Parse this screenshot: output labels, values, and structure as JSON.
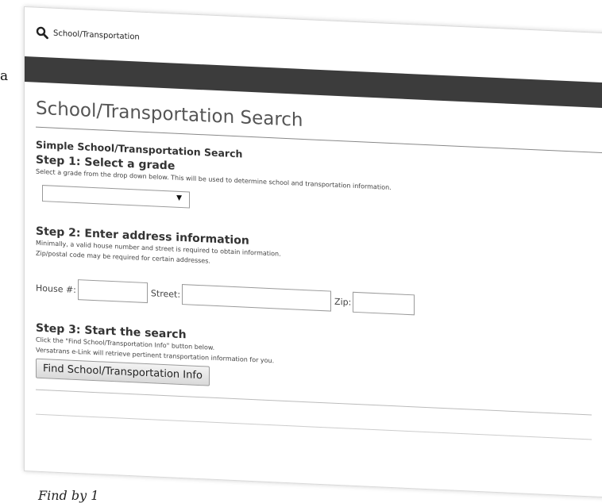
{
  "background": {
    "left_fragment": "a",
    "caption": "Find by 1"
  },
  "app": {
    "title": "School/Transportation",
    "icon": "search-icon"
  },
  "page": {
    "title": "School/Transportation Search",
    "section_title": "Simple School/Transportation Search"
  },
  "step1": {
    "title": "Step 1: Select a grade",
    "help": "Select a grade from the drop down below. This will be used to determine school and transportation information.",
    "grade_value": "",
    "arrow": "▼"
  },
  "step2": {
    "title": "Step 2: Enter address information",
    "help_line1": "Minimally, a valid house number and street is required to obtain information.",
    "help_line2": "Zip/postal code may be required for certain addresses.",
    "house_label": "House #:",
    "street_label": "Street:",
    "zip_label": "Zip:",
    "house_value": "",
    "street_value": "",
    "zip_value": ""
  },
  "step3": {
    "title": "Step 3: Start the search",
    "help_line1": "Click the \"Find School/Transportation Info\" button below.",
    "help_line2": "Versatrans e-Link will retrieve pertinent transportation information for you.",
    "button_label": "Find School/Transportation Info"
  },
  "colors": {
    "band": "#3c3c3c",
    "title_text": "#555555"
  }
}
